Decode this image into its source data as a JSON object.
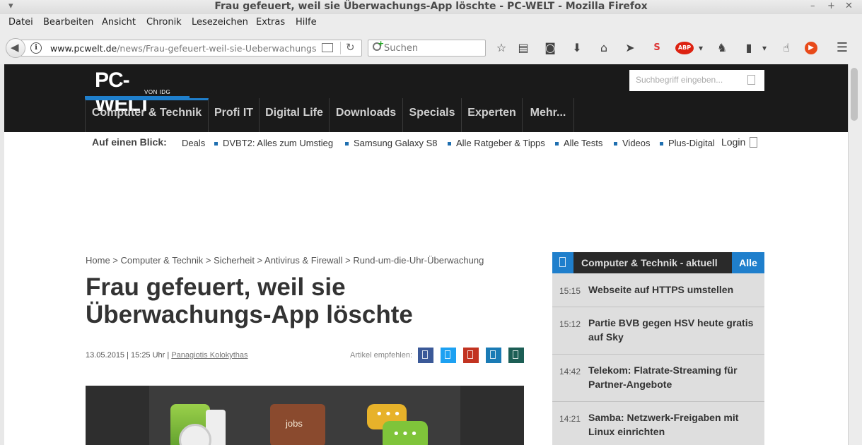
{
  "window": {
    "title": "Frau gefeuert, weil sie Überwachungs-App löschte - PC-WELT - Mozilla Firefox",
    "menu": [
      "Datei",
      "Bearbeiten",
      "Ansicht",
      "Chronik",
      "Lesezeichen",
      "Extras",
      "Hilfe"
    ],
    "controls": {
      "collapse": "▾",
      "minimize": "–",
      "maximize": "+",
      "close": "✕"
    }
  },
  "navbar": {
    "back_icon": "◀",
    "info_icon": "i",
    "url_domain": "www.pcwelt.de",
    "url_path": "/news/Frau-gefeuert-weil-sie-Ueberwachungs",
    "reload_icon": "↻",
    "search_placeholder": "Suchen",
    "toolbar_icons": [
      "☆",
      "▤",
      "◙",
      "⬇",
      "⌂",
      "➤",
      "S",
      "ABP",
      "▾",
      "♞",
      "▮",
      "▾",
      "☝",
      "▶",
      "☰"
    ]
  },
  "site": {
    "logo_text": "PC-WELT",
    "logo_sub": "VON IDG",
    "search_placeholder": "Suchbegriff eingeben...",
    "nav": [
      "Computer & Technik",
      "Profi IT",
      "Digital Life",
      "Downloads",
      "Specials",
      "Experten",
      "Mehr..."
    ],
    "glance_label": "Auf einen Blick:",
    "glance_links": [
      "Deals",
      "DVBT2: Alles zum Umstieg",
      "Samsung Galaxy S8",
      "Alle Ratgeber & Tipps",
      "Alle Tests",
      "Videos",
      "Plus-Digital"
    ],
    "login": "Login"
  },
  "article": {
    "breadcrumb": "Home > Computer & Technik > Sicherheit > Antivirus & Firewall > Rund-um-die-Uhr-Überwachung",
    "headline": "Frau gefeuert, weil sie Überwachungs-App löschte",
    "date": "13.05.2015 | 15:25 Uhr | ",
    "author": "Panagiotis Kolokythas",
    "recommend_label": "Artikel empfehlen:",
    "share_colors": [
      "#3b5998",
      "#1da1f2",
      "#c23321",
      "#1a7bb5",
      "#1c5e55"
    ],
    "hero_wallet_text": "jobs",
    "hero_dots": "•••"
  },
  "sidebar": {
    "title": "Computer & Technik - aktuell",
    "all_label": "Alle",
    "items": [
      {
        "time": "15:15",
        "text": "Webseite auf HTTPS umstellen"
      },
      {
        "time": "15:12",
        "text": "Partie BVB gegen HSV heute gratis auf Sky"
      },
      {
        "time": "14:42",
        "text": "Telekom: Flatrate-Streaming für Partner-Angebote"
      },
      {
        "time": "14:21",
        "text": "Samba: Netzwerk-Freigaben mit Linux einrichten"
      }
    ]
  },
  "colors": {
    "accent": "#1f7fcc",
    "header_bg": "#1a1a1a",
    "sidebar_item_bg": "#dedede"
  }
}
